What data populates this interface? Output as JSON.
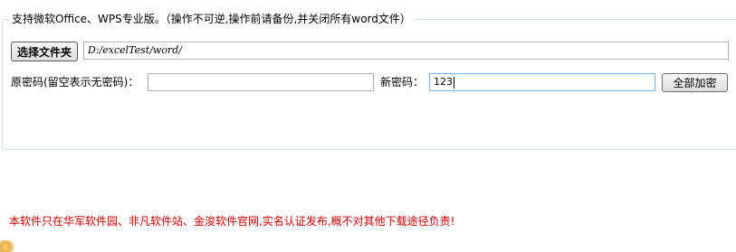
{
  "panel": {
    "legend": "支持微软Office、WPS专业版。（操作不可逆,操作前请备份,并关闭所有word文件）"
  },
  "folder": {
    "button_label": "选择文件夹",
    "path_value": "D:/excelTest/word/"
  },
  "password": {
    "old_label": "原密码(留空表示无密码)：",
    "old_value": "",
    "new_label": "新密码：",
    "new_value": "123",
    "encrypt_button_label": "全部加密"
  },
  "footer": {
    "notice": "本软件只在华军软件园、非凡软件站、金浚软件官网,实名认证发布,概不对其他下载途径负责!",
    "notice_color": "#cc0000"
  }
}
